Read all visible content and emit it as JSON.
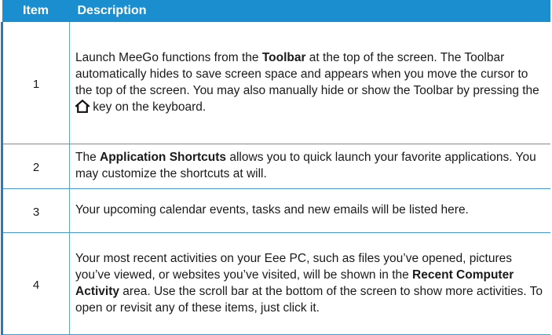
{
  "header": {
    "item": "Item",
    "description": "Description"
  },
  "rows": [
    {
      "item": "1",
      "parts": [
        "Launch MeeGo functions from the ",
        "Toolbar",
        " at the top of the screen. The Toolbar automatically hides to save screen space and appears when you move the cursor to the top of the screen. You may also manually hide or show the Toolbar by pressing the ",
        " key on the keyboard."
      ],
      "icon": "home-key-icon"
    },
    {
      "item": "2",
      "parts": [
        "The ",
        "Application Shortcuts",
        " allows you to quick launch your favorite applications. You may customize the shortcuts at will."
      ]
    },
    {
      "item": "3",
      "text": "Your upcoming calendar events, tasks and new emails will be listed here."
    },
    {
      "item": "4",
      "parts": [
        "Your most recent activities on your Eee PC, such as files you’ve opened, pictures you’ve viewed, or websites you’ve visited, will be shown in the ",
        "Recent Computer Activity",
        " area. Use the scroll bar at the bottom of the screen to show more activities. To open or revisit any of these items, just click it."
      ]
    }
  ]
}
